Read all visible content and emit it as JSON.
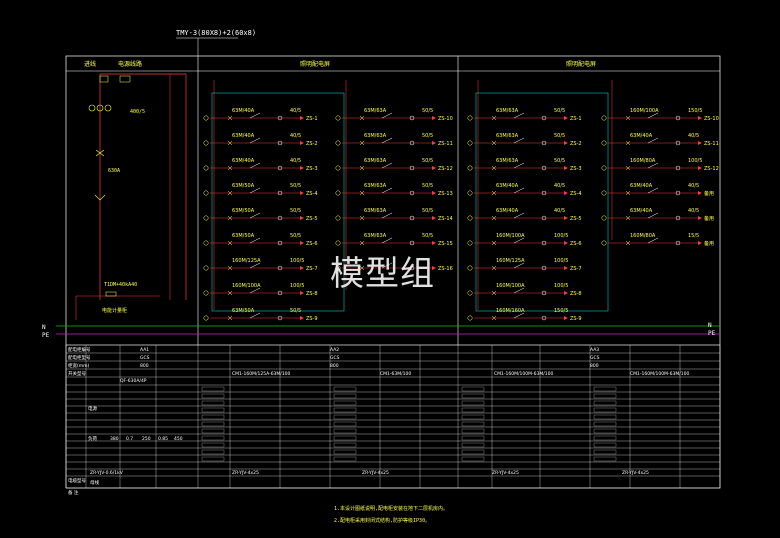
{
  "busbar_label": "TMY-3(80X8)+2(60x8)",
  "watermark": "模型组",
  "sections": {
    "incoming": {
      "title_left": "进线",
      "title_right": "电源线路"
    },
    "lighting_a": {
      "title": "照明配电屏"
    },
    "lighting_b": {
      "title": "照明配电屏"
    }
  },
  "incoming_labels": {
    "ct": "400/5",
    "breaker": "630A",
    "spd": "T1DM+40kA40",
    "cabinet": "电能计量柜"
  },
  "bus_labels": {
    "n": "N",
    "pe": "PE"
  },
  "panel1_circuits": [
    {
      "rating": "63M/40A",
      "ct": "40/5",
      "label": "ZS-1"
    },
    {
      "rating": "63M/40A",
      "ct": "40/5",
      "label": "ZS-2"
    },
    {
      "rating": "63M/40A",
      "ct": "40/5",
      "label": "ZS-3"
    },
    {
      "rating": "63M/50A",
      "ct": "50/5",
      "label": "ZS-4"
    },
    {
      "rating": "63M/50A",
      "ct": "50/5",
      "label": "ZS-5"
    },
    {
      "rating": "63M/50A",
      "ct": "50/5",
      "label": "ZS-6"
    },
    {
      "rating": "160M/125A",
      "ct": "100/5",
      "label": "ZS-7"
    },
    {
      "rating": "160M/100A",
      "ct": "100/5",
      "label": "ZS-8"
    },
    {
      "rating": "63M/50A",
      "ct": "50/5",
      "label": "ZS-9"
    }
  ],
  "panel2_circuits": [
    {
      "rating": "63M/63A",
      "ct": "50/5",
      "label": "ZS-10"
    },
    {
      "rating": "63M/63A",
      "ct": "50/5",
      "label": "ZS-11"
    },
    {
      "rating": "63M/63A",
      "ct": "50/5",
      "label": "ZS-12"
    },
    {
      "rating": "63M/63A",
      "ct": "50/5",
      "label": "ZS-13"
    },
    {
      "rating": "63M/63A",
      "ct": "50/5",
      "label": "ZS-14"
    },
    {
      "rating": "63M/63A",
      "ct": "50/5",
      "label": "ZS-15"
    },
    {
      "rating": "",
      "ct": "",
      "label": "ZS-16"
    },
    {
      "rating": "",
      "ct": "",
      "label": ""
    },
    {
      "rating": "",
      "ct": "",
      "label": ""
    }
  ],
  "panel3_circuits": [
    {
      "rating": "63M/63A",
      "ct": "50/5",
      "label": "ZS-1"
    },
    {
      "rating": "63M/63A",
      "ct": "50/5",
      "label": "ZS-2"
    },
    {
      "rating": "63M/63A",
      "ct": "50/5",
      "label": "ZS-3"
    },
    {
      "rating": "63M/40A",
      "ct": "40/5",
      "label": "ZS-4"
    },
    {
      "rating": "63M/40A",
      "ct": "40/5",
      "label": "ZS-5"
    },
    {
      "rating": "160M/100A",
      "ct": "100/5",
      "label": "ZS-6"
    },
    {
      "rating": "160M/125A",
      "ct": "100/5",
      "label": "ZS-7"
    },
    {
      "rating": "160M/100A",
      "ct": "100/5",
      "label": "ZS-8"
    },
    {
      "rating": "160M/160A",
      "ct": "150/5",
      "label": "ZS-9"
    }
  ],
  "panel4_circuits": [
    {
      "rating": "160M/100A",
      "ct": "150/5",
      "label": "ZS-10"
    },
    {
      "rating": "63M/40A",
      "ct": "40/5",
      "label": "ZS-11"
    },
    {
      "rating": "160M/80A",
      "ct": "100/5",
      "label": "ZS-12"
    },
    {
      "rating": "63M/40A",
      "ct": "40/5",
      "label": "备用"
    },
    {
      "rating": "63M/40A",
      "ct": "40/5",
      "label": "备用"
    },
    {
      "rating": "160M/80A",
      "ct": "15/5",
      "label": "备用"
    },
    {
      "rating": "",
      "ct": "",
      "label": ""
    },
    {
      "rating": "",
      "ct": "",
      "label": ""
    },
    {
      "rating": "",
      "ct": "",
      "label": ""
    }
  ],
  "table": {
    "row_labels": [
      "配电柜编号",
      "配电柜型号",
      "柜宽(mm)",
      "开关型号",
      "",
      "",
      "",
      "",
      "",
      "",
      "",
      "",
      "",
      "",
      "",
      "",
      "",
      "",
      "电缆型号",
      "备 注"
    ],
    "panel_ids": [
      "AA1",
      "AA2",
      "AA3"
    ],
    "panel_types": [
      "GCS",
      "GCS",
      "GCS"
    ],
    "widths": [
      "800",
      "800",
      "800"
    ],
    "switch_models": [
      "QF-630A/4P",
      "CM1-160M/125A-63M/100",
      "CM1-63M/100",
      "CM1-160M/100M-63M/100",
      "CM1-160M/100M-63M/100"
    ],
    "incoming_rows": [
      "电源",
      "负荷"
    ],
    "incoming_values": [
      "380",
      "0.7",
      "250",
      "0.85",
      "450"
    ],
    "cable_in": "ZR-YJV-0.6/1kV",
    "cable_values": [
      "ZR-YJV-4x25",
      "ZR-YJV-4x25",
      "ZR-YJV-4x25",
      "ZR-YJV-4x25"
    ],
    "remark": "母线"
  },
  "notes": [
    "1.本设计图纸说明,配电柜安装在地下二层机房内。",
    "2.配电柜采用封闭式结构,防护等级IP30。"
  ],
  "colors": {
    "background": "#000000",
    "frame": "#ffffff",
    "wire_red": "#ff3b3b",
    "wire_cyan": "#00c8c8",
    "bus_magenta": "#d020d0",
    "bus_green": "#10c010",
    "text_yellow": "#ffff40",
    "text_white": "#ffffff"
  }
}
